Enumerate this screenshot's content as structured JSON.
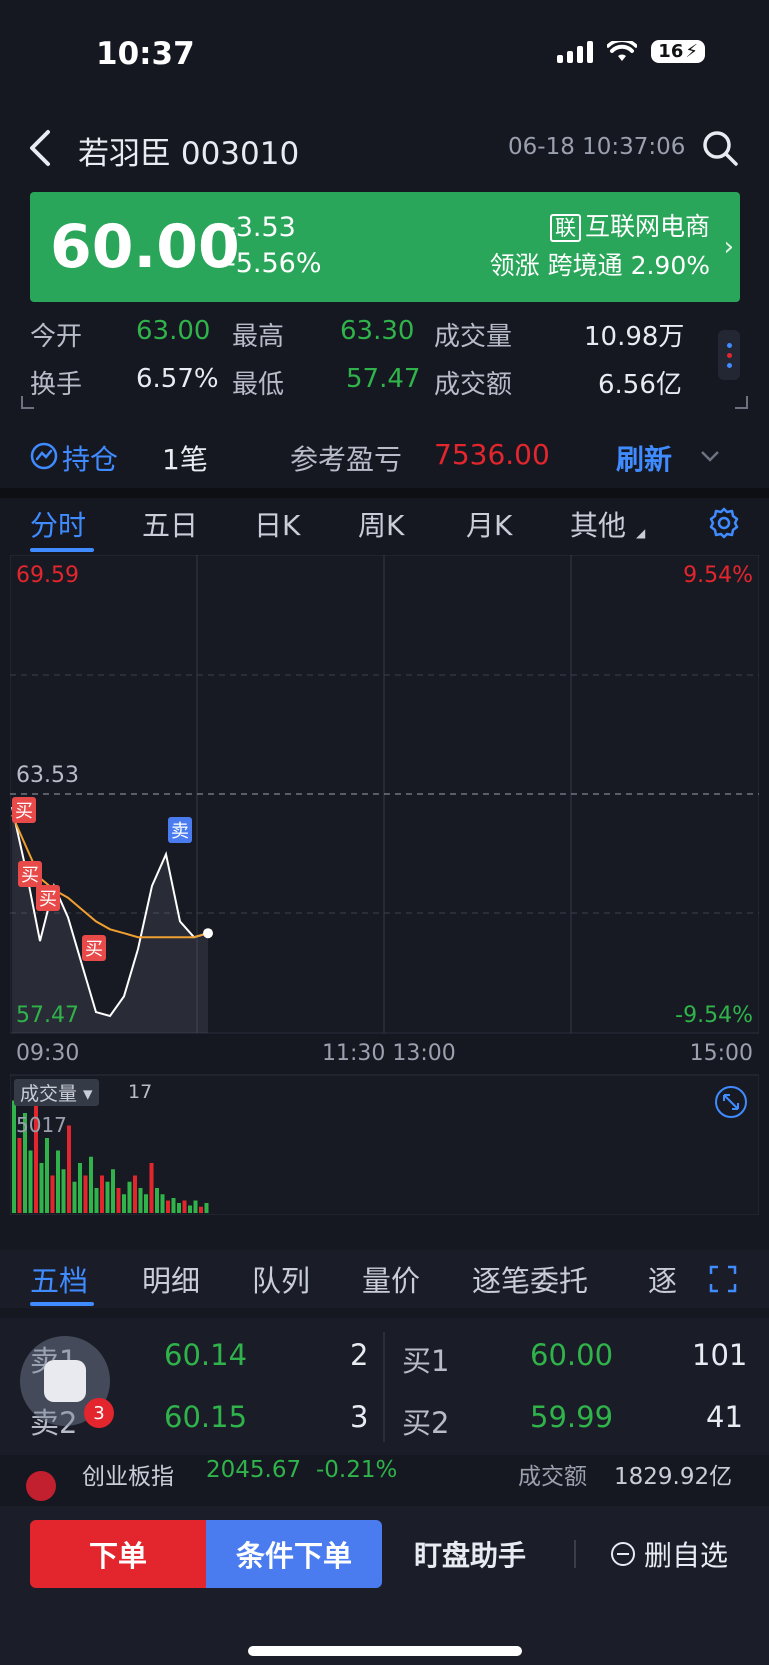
{
  "status_bar": {
    "time": "10:37",
    "battery": "16"
  },
  "header": {
    "stock_name": "若羽臣 003010",
    "datetime": "06-18 10:37:06"
  },
  "quote": {
    "price": "60.00",
    "change": "-3.53",
    "change_pct": "-5.56%",
    "sector_tag": "联",
    "sector_name": "互联网电商",
    "sector_line": "领涨 跨境通 2.90%"
  },
  "stats": {
    "open_label": "今开",
    "open": "63.00",
    "high_label": "最高",
    "high": "63.30",
    "volume_label": "成交量",
    "volume": "10.98万",
    "turnover_label": "换手",
    "turnover": "6.57%",
    "low_label": "最低",
    "low": "57.47",
    "amount_label": "成交额",
    "amount": "6.56亿"
  },
  "holdings": {
    "label": "持仓",
    "count": "1笔",
    "pnl_label": "参考盈亏",
    "pnl": "7536.00",
    "refresh": "刷新"
  },
  "chart_tabs": [
    "分时",
    "五日",
    "日K",
    "周K",
    "月K",
    "其他"
  ],
  "chart": {
    "top_price": "69.59",
    "top_pct": "9.54%",
    "mid_price": "63.53",
    "bottom_price": "57.47",
    "bottom_pct": "-9.54%",
    "time_labels": [
      "09:30",
      "11:30 13:00",
      "15:00"
    ],
    "trade_marks": [
      "买",
      "买",
      "买",
      "买",
      "卖"
    ],
    "volume_label": "成交量",
    "volume_last": "17",
    "volume_max": "5017"
  },
  "chart_data": {
    "type": "line",
    "x": [
      "09:30",
      "09:35",
      "09:40",
      "09:45",
      "09:50",
      "09:55",
      "10:00",
      "10:05",
      "10:10",
      "10:15",
      "10:20",
      "10:25",
      "10:30",
      "10:35",
      "10:37"
    ],
    "series": [
      {
        "values": [
          63.2,
          61.6,
          59.8,
          61.2,
          60.4,
          59.2,
          58.0,
          57.9,
          58.4,
          59.6,
          61.2,
          62.0,
          60.3,
          59.9,
          60.0
        ]
      },
      {
        "values": [
          63.0,
          62.2,
          61.4,
          61.1,
          60.9,
          60.6,
          60.3,
          60.1,
          60.0,
          59.9,
          59.9,
          59.9,
          59.9,
          59.9,
          60.0
        ]
      }
    ],
    "ylim": [
      57.47,
      69.59
    ]
  },
  "level2_tabs": [
    "五档",
    "明细",
    "队列",
    "量价",
    "逐笔委托",
    "逐"
  ],
  "order_book": {
    "asks": [
      {
        "label": "卖1",
        "price": "60.14",
        "qty": "2"
      },
      {
        "label": "卖2",
        "price": "60.15",
        "qty": "3"
      }
    ],
    "bids": [
      {
        "label": "买1",
        "price": "60.00",
        "qty": "101"
      },
      {
        "label": "买2",
        "price": "59.99",
        "qty": "41"
      }
    ]
  },
  "index_ticker": {
    "name": "创业板指",
    "value": "2045.67",
    "pct": "-0.21%",
    "amount_label": "成交额",
    "amount": "1829.92亿"
  },
  "assistant_badge": "3",
  "bottom_bar": {
    "order": "下单",
    "conditional": "条件下单",
    "helper": "盯盘助手",
    "remove": "删自选"
  },
  "colors": {
    "up": "#e3262d",
    "down": "#2fb34a",
    "accent": "#3f8bff",
    "banner": "#2aa65a"
  }
}
